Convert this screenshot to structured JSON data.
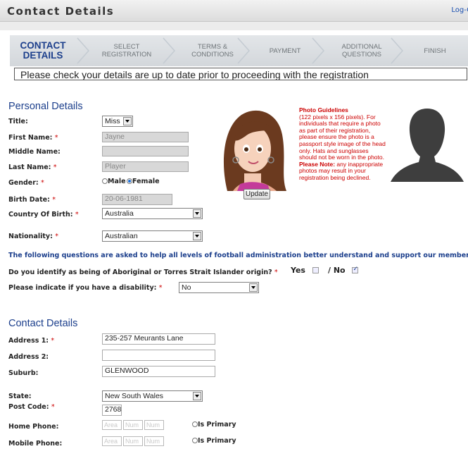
{
  "header": {
    "title": "Contact Details",
    "logout": "Log-O"
  },
  "steps": [
    {
      "line1": "CONTACT",
      "line2": "DETAILS",
      "active": true
    },
    {
      "line1": "SELECT",
      "line2": "REGISTRATION",
      "active": false
    },
    {
      "line1": "TERMS &",
      "line2": "CONDITIONS",
      "active": false
    },
    {
      "line1": "PAYMENT",
      "line2": "",
      "active": false
    },
    {
      "line1": "ADDITIONAL",
      "line2": "QUESTIONS",
      "active": false
    },
    {
      "line1": "FINISH",
      "line2": "",
      "active": false
    }
  ],
  "notice": "Please check your details are up to date prior to proceeding with the registration",
  "personal": {
    "heading": "Personal Details",
    "title_label": "Title:",
    "title_value": "Miss",
    "first_label": "First Name:",
    "first_value": "Jayne",
    "middle_label": "Middle Name:",
    "middle_value": "",
    "last_label": "Last Name:",
    "last_value": "Player",
    "gender_label": "Gender:",
    "male": "Male",
    "female": "Female",
    "birth_label": "Birth Date:",
    "birth_value": "20-06-1981",
    "country_label": "Country Of Birth:",
    "country_value": "Australia",
    "nat_label": "Nationality:",
    "nat_value": "Australian",
    "required": "*"
  },
  "photo": {
    "update": "Update",
    "g_title": "Photo Guidelines",
    "g_text": "(122 pixels x 156 pixels). For individuals that require a photo as part of their registration, please ensure the photo is a passport style image of the head only. Hats and sunglasses should not be worn in the photo.",
    "note_title": "Please Note:",
    "note_text": " any inappropriate photos may result in your registration being declined."
  },
  "info_line": "The following questions are asked to help all levels of football administration better understand and support our members",
  "q1": {
    "text": "Do you identify as being of Aboriginal or Torres Strait Islander origin?",
    "yes": "Yes",
    "slash": "/ No"
  },
  "q2": {
    "text": "Please indicate if you have a disability:",
    "value": "No"
  },
  "contact": {
    "heading": "Contact Details",
    "addr1_label": "Address 1:",
    "addr1_value": "235-257 Meurants Lane",
    "addr2_label": "Address 2:",
    "addr2_value": "",
    "suburb_label": "Suburb:",
    "suburb_value": "GLENWOOD",
    "state_label": "State:",
    "state_value": "New South Wales",
    "post_label": "Post Code:",
    "post_value": "2768",
    "home_label": "Home Phone:",
    "mobile_label": "Mobile Phone:",
    "area": "Area",
    "num": "Num",
    "primary": "Is Primary"
  },
  "colors": {
    "accent": "#1c3f8c",
    "required": "#cc0000"
  }
}
